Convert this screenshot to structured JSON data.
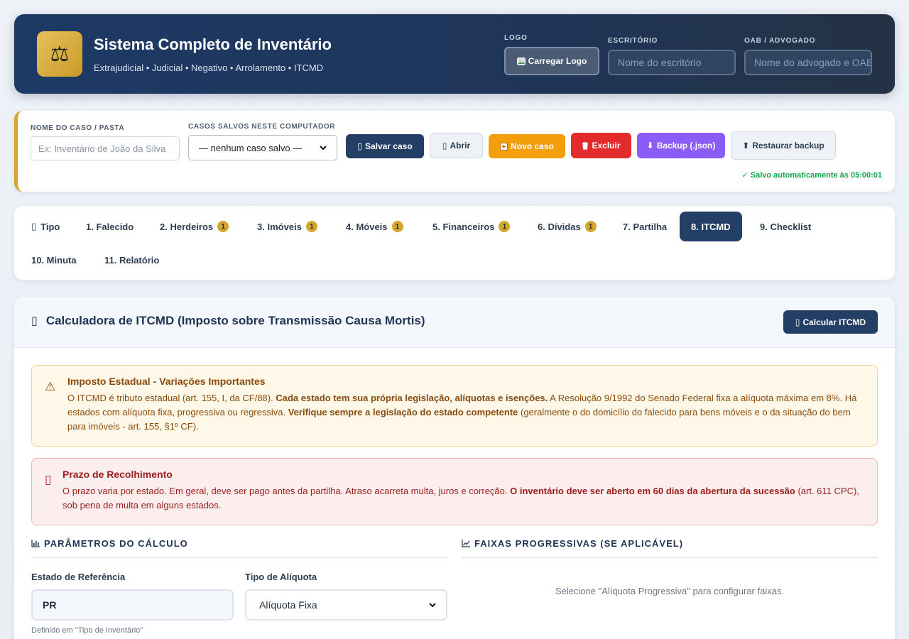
{
  "header": {
    "logo_glyph": "⚖",
    "title": "Sistema Completo de Inventário",
    "subtitle": "Extrajudicial • Judicial • Negativo • Arrolamento • ITCMD",
    "logo_label": "LOGO",
    "load_logo_button": "Carregar Logo",
    "office_label": "ESCRITÓRIO",
    "office_placeholder": "Nome do escritório",
    "oab_label": "OAB / ADVOGADO",
    "oab_placeholder": "Nome do advogado e OAB"
  },
  "casebar": {
    "name_label": "NOME DO CASO / PASTA",
    "name_placeholder": "Ex: Inventário de João da Silva",
    "saved_label": "CASOS SALVOS NESTE COMPUTADOR",
    "saved_selected": "— nenhum caso salvo —",
    "buttons": {
      "save": "Salvar caso",
      "open": "Abrir",
      "new": "Novo caso",
      "delete": "Excluir",
      "backup": "Backup (.json)",
      "restore": "Restaurar backup"
    },
    "autosave_status": "✓ Salvo automaticamente às 05:00:01"
  },
  "tabs": [
    {
      "label": "Tipo",
      "badge": ""
    },
    {
      "label": "1. Falecido",
      "badge": ""
    },
    {
      "label": "2. Herdeiros",
      "badge": "1"
    },
    {
      "label": "3. Imóveis",
      "badge": "1"
    },
    {
      "label": "4. Móveis",
      "badge": "1"
    },
    {
      "label": "5. Financeiros",
      "badge": "1"
    },
    {
      "label": "6. Dívidas",
      "badge": "1"
    },
    {
      "label": "7. Partilha",
      "badge": ""
    },
    {
      "label": "8. ITCMD",
      "badge": "",
      "active": true
    },
    {
      "label": "9. Checklist",
      "badge": ""
    },
    {
      "label": "10. Minuta",
      "badge": ""
    },
    {
      "label": "11. Relatório",
      "badge": ""
    }
  ],
  "panel": {
    "title": "Calculadora de ITCMD (Imposto sobre Transmissão Causa Mortis)",
    "calc_button": "Calcular ITCMD",
    "warning": {
      "title": "Imposto Estadual - Variações Importantes",
      "t1": "O ITCMD é tributo estadual (art. 155, I, da CF/88). ",
      "b1": "Cada estado tem sua própria legislação, alíquotas e isenções.",
      "t2": " A Resolução 9/1992 do Senado Federal fixa a alíquota máxima em 8%. Há estados com alíquota fixa, progressiva ou regressiva. ",
      "b2": "Verifique sempre a legislação do estado competente",
      "t3": " (geralmente o do domicílio do falecido para bens móveis e o da situação do bem para imóveis - art. 155, §1º CF)."
    },
    "deadline": {
      "title": "Prazo de Recolhimento",
      "t1": "O prazo varia por estado. Em geral, deve ser pago antes da partilha. Atraso acarreta multa, juros e correção. ",
      "b1": "O inventário deve ser aberto em 60 dias da abertura da sucessão",
      "t2": " (art. 611 CPC), sob pena de multa em alguns estados."
    },
    "params_heading": "PARÂMETROS DO CÁLCULO",
    "ranges_heading": "FAIXAS PROGRESSIVAS (SE APLICÁVEL)",
    "state_label": "Estado de Referência",
    "state_value": "PR",
    "state_hint": "Definido em \"Tipo de Inventário\"",
    "rate_label": "Tipo de Alíquota",
    "rate_value": "Alíquota Fixa",
    "ranges_empty": "Selecione \"Alíquota Progressiva\" para configurar faixas."
  }
}
